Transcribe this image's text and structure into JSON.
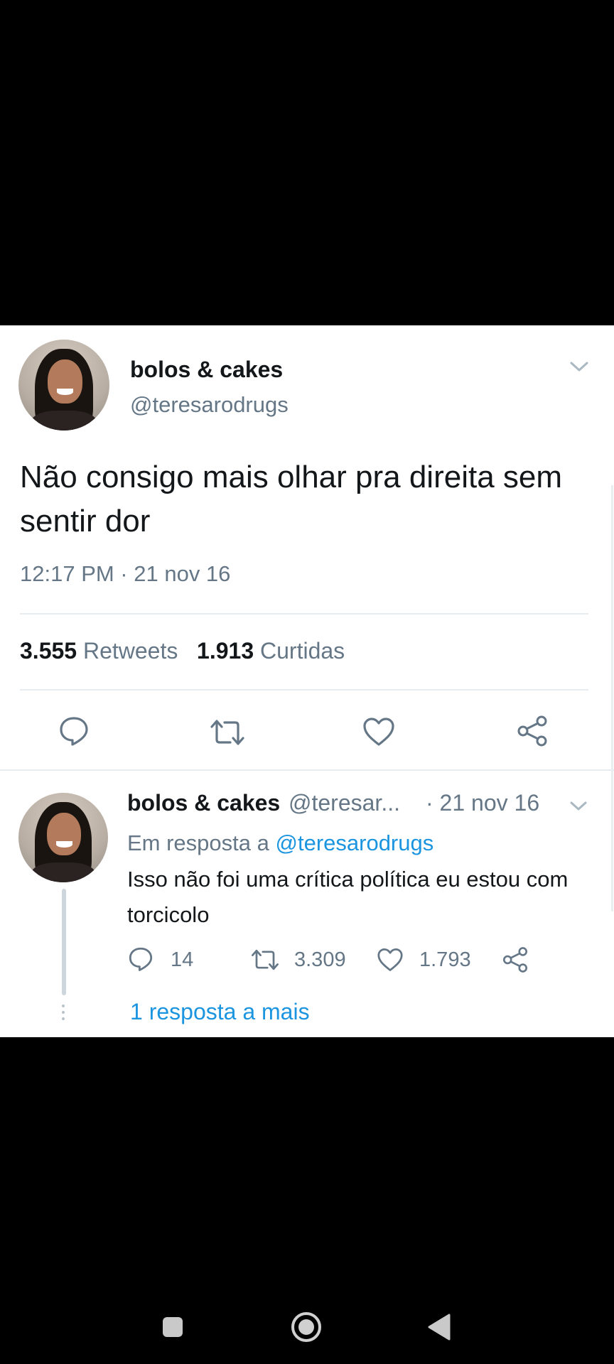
{
  "tweet": {
    "display_name": "bolos & cakes",
    "handle": "@teresarodrugs",
    "text": "Não consigo mais olhar pra direita sem sentir dor",
    "timestamp": "12:17 PM · 21 nov 16",
    "retweets_count": "3.555",
    "retweets_label": "Retweets",
    "likes_count": "1.913",
    "likes_label": "Curtidas",
    "actions": [
      "reply-icon",
      "retweet-icon",
      "like-icon",
      "share-icon"
    ]
  },
  "reply": {
    "display_name": "bolos & cakes",
    "handle": "@teresar...",
    "date": "· 21 nov 16",
    "reply_prefix": "Em resposta a",
    "reply_mention": "@teresarodrugs",
    "text": "Isso não foi uma crítica política eu estou com torcicolo",
    "replies": "14",
    "retweets": "3.309",
    "likes": "1.793",
    "more_replies": "1 resposta a mais"
  },
  "colors": {
    "text": "#14171a",
    "secondary": "#657786",
    "link": "#1b95e0",
    "divider": "#e6ecf0"
  },
  "system_nav": [
    "recents-button",
    "home-button",
    "back-button"
  ]
}
